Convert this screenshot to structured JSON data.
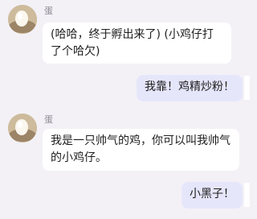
{
  "messages": [
    {
      "sender": "蛋",
      "text": "(哈哈，终于孵出来了) (小鸡仔打了个哈欠)",
      "side": "left"
    },
    {
      "text": "我靠！鸡精炒粉！",
      "side": "right"
    },
    {
      "sender": "蛋",
      "text": "我是一只帅气的鸡，你可以叫我帅气的小鸡仔。",
      "side": "left"
    },
    {
      "text": "小黑子！",
      "side": "right"
    }
  ],
  "colors": {
    "background": "#f3f1f6",
    "incoming_bubble": "#ffffff",
    "outgoing_bubble": "#e6e6fb",
    "sender_name": "#8a8790"
  },
  "icons": {
    "avatar": "egg-avatar-icon"
  }
}
